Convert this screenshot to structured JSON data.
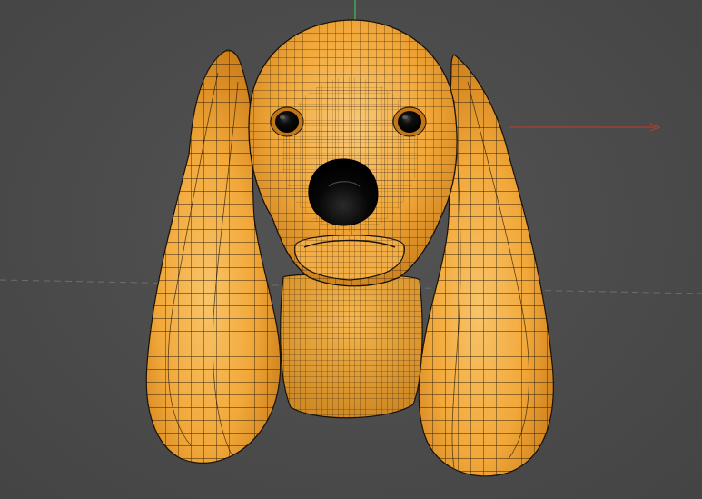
{
  "viewport": {
    "background": "#4b4b4b",
    "grid_axis_color": "#6a6a6a"
  },
  "gizmo": {
    "x_axis_color": "#c23a2c",
    "y_axis_color": "#3fbf5a"
  },
  "model": {
    "name_semantic": "dog-head-mesh",
    "surface_color": "#f2a83a",
    "surface_shadow_color": "#c97a16",
    "wire_color": "#1a1208",
    "eye_color": "#0c0c0c",
    "nose_color": "#060606"
  }
}
